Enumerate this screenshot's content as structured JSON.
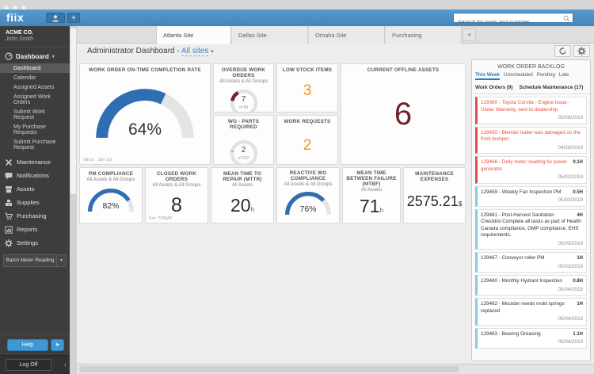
{
  "colors": {
    "topbar_blue": "#4a8cc2",
    "gauge_blue": "#2f6eb2",
    "accent_orange": "#f6921e",
    "alert_maroon": "#6e2424",
    "backlog_red": "#e8503a",
    "link_blue": "#3787c6"
  },
  "topbar": {
    "logo": "fiix",
    "add_label": "+",
    "search": {
      "placeholder": "Search for parts and supplies..."
    }
  },
  "sidebar": {
    "company": "ACME CO.",
    "user": "John Smith",
    "dashboard_menu": {
      "label": "Dashboard",
      "caret": "▾",
      "items": [
        "Dashboard",
        "Calendar",
        "Assigned Assets",
        "Assigned Work Orders",
        "Submit Work Request",
        "My Purchase Requests",
        "Submit Purchase Request"
      ]
    },
    "nav": [
      {
        "label": "Maintenance",
        "icon": "tools-icon"
      },
      {
        "label": "Notifications",
        "icon": "chat-bubble-icon"
      },
      {
        "label": "Assets",
        "icon": "assets-box-icon"
      },
      {
        "label": "Supplies",
        "icon": "supplies-icon"
      },
      {
        "label": "Purchasing",
        "icon": "cart-icon"
      },
      {
        "label": "Reports",
        "icon": "bar-chart-icon"
      },
      {
        "label": "Settings",
        "icon": "gear-icon"
      }
    ],
    "batch_meter_button": "Batch Meter Reading",
    "batch_caret": "▾",
    "help_button": "Help",
    "help_mini_icon": "➤",
    "logoff_button": "Log Off",
    "collapse_chevron": "‹"
  },
  "tabs": [
    {
      "label": "Atlanta Site",
      "active": true
    },
    {
      "label": "Dallas Site",
      "active": false
    },
    {
      "label": "Omaha Site",
      "active": false
    },
    {
      "label": "Purchasing",
      "active": false
    }
  ],
  "new_tab_label": "+",
  "page_header": {
    "title": "Administrator Dashboard -",
    "site_selector": "All sites",
    "caret": "▾"
  },
  "widgets": {
    "completion_rate": {
      "title": "WORK ORDER ON-TIME COMPLETION RATE",
      "value": "64%",
      "percent": 64,
      "footnote": "Since : Jan 1st"
    },
    "overdue": {
      "title": "OVERDUE WORK ORDERS",
      "subtitle": "All Assets & All Groups",
      "value": "7",
      "of": "of 49",
      "percent": 14,
      "color": "#6e2424"
    },
    "parts_required": {
      "title": "WO - PARTS REQUIRED",
      "value": "2",
      "of": "of 207",
      "percent": 1,
      "color": "#8a8a8a"
    },
    "low_stock": {
      "title": "LOW STOCK ITEMS",
      "value": "3"
    },
    "work_requests": {
      "title": "WORK REQUESTS",
      "value": "2"
    },
    "offline_assets": {
      "title": "CURRENT OFFLINE ASSETS",
      "value": "6"
    },
    "pm_compliance": {
      "title": "PM COMPLIANCE",
      "subtitle": "All Assets & All Groups",
      "value": "82%",
      "percent": 82
    },
    "closed_wo": {
      "title": "CLOSED WORK ORDERS",
      "subtitle": "All Assets & All Groups",
      "value": "8",
      "footnote": "For: TODAY"
    },
    "mttr": {
      "title": "MEAN TIME TO REPAIR (MTTR)",
      "subtitle": "All Assets",
      "value": "20",
      "unit": "h"
    },
    "reactive": {
      "title": "REACTIVE WO COMPLIANCE",
      "subtitle": "All Assets & All Groups",
      "value": "76%",
      "percent": 76
    },
    "mtbf": {
      "title": "MEAN TIME BETWEEN FAILURE (MTBF)",
      "subtitle": "All Assets",
      "value": "71",
      "unit": "h"
    },
    "expenses": {
      "title": "MAINTENANCE EXPENSES",
      "value": "2575.21",
      "unit": "$"
    }
  },
  "backlog": {
    "title": "WORK ORDER BACKLOG",
    "tabs": [
      "This Week",
      "Unscheduled",
      "Pending",
      "Late"
    ],
    "active_tab": "This Week",
    "groups": [
      {
        "label": "Work Orders (9)"
      },
      {
        "label": "Schedule Maintenance (17)"
      }
    ],
    "items": [
      {
        "text": "129360 - Toyota Corolla - Engine Issue - Under Warranty, sent to dealership",
        "hours": "",
        "date": "02/09/2019",
        "status": "late"
      },
      {
        "text": "129450 - Blender trailer was damaged on the front bumper",
        "hours": "",
        "date": "04/29/2019",
        "status": "late"
      },
      {
        "text": "129466 - Daily meter reading for power generator",
        "hours": "0.1H",
        "date": "05/02/2019",
        "status": "late"
      },
      {
        "text": "129459 - Weekly Fan Inspection PM",
        "hours": "0.5H",
        "date": "05/03/2019",
        "status": "scheduled"
      },
      {
        "text": "129461 - Post-Harvest Sanitation Checklist Complete all tasks as part of Health Canada compliance, GMP compliance, EHS requirements.",
        "hours": "4H",
        "date": "05/03/2019",
        "status": "scheduled"
      },
      {
        "text": "129467 - Conveyor roller PM",
        "hours": "1H",
        "date": "05/03/2019",
        "status": "scheduled"
      },
      {
        "text": "129460 - Monthly Hydrant Inspection",
        "hours": "0.8H",
        "date": "05/04/2019",
        "status": "scheduled"
      },
      {
        "text": "129462 - Moulder needs mold springs replaced",
        "hours": "1H",
        "date": "05/04/2019",
        "status": "scheduled"
      },
      {
        "text": "129463 - Bearing Greasing",
        "hours": "1.1H",
        "date": "05/04/2019",
        "status": "scheduled"
      }
    ]
  }
}
